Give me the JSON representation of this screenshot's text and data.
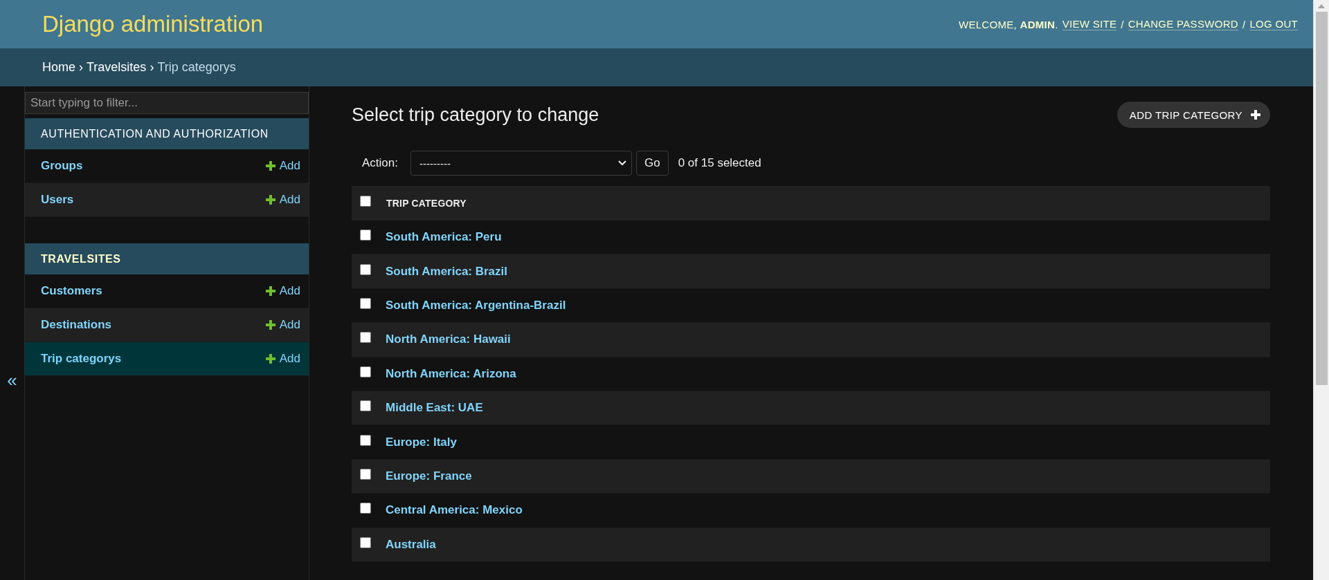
{
  "header": {
    "title": "Django administration",
    "welcome": "WELCOME, **ADMIN**.",
    "links": [
      "VIEW SITE",
      "CHANGE PASSWORD",
      "LOG OUT"
    ],
    "separator": "/"
  },
  "breadcrumbs": {
    "items": [
      "Home",
      "Travelsites",
      "Trip categorys"
    ],
    "separator": "›"
  },
  "sidebar": {
    "filter": {
      "placeholder": "Start typing to filter..."
    },
    "toggle": "«",
    "modules": [
      {
        "title": "AUTHENTICATION AND AUTHORIZATION",
        "current": false,
        "models": [
          {
            "name": "Groups",
            "add": "Add",
            "selected": false
          },
          {
            "name": "Users",
            "add": "Add",
            "selected": false
          }
        ]
      },
      {
        "title": "TRAVELSITES",
        "current": true,
        "models": [
          {
            "name": "Customers",
            "add": "Add",
            "selected": false
          },
          {
            "name": "Destinations",
            "add": "Add",
            "selected": false
          },
          {
            "name": "Trip categorys",
            "add": "Add",
            "selected": true
          }
        ]
      }
    ]
  },
  "content": {
    "title": "Select trip category to change",
    "add_button": "ADD TRIP CATEGORY",
    "actions": {
      "label": "Action:",
      "value": "---------",
      "go": "Go",
      "counter": "0 of 15 selected"
    },
    "table": {
      "columns": [
        "TRIP CATEGORY"
      ],
      "select_all": {
        "checked": false
      },
      "rows": [
        {
          "name": "South America: Peru",
          "checked": false
        },
        {
          "name": "South America: Brazil",
          "checked": false
        },
        {
          "name": "South America: Argentina-Brazil",
          "checked": false
        },
        {
          "name": "North America: Hawaii",
          "checked": false
        },
        {
          "name": "North America: Arizona",
          "checked": false
        },
        {
          "name": "Middle East: UAE",
          "checked": false
        },
        {
          "name": "Europe: Italy",
          "checked": false
        },
        {
          "name": "Europe: France",
          "checked": false
        },
        {
          "name": "Central America: Mexico",
          "checked": false
        },
        {
          "name": "Australia",
          "checked": false
        }
      ]
    }
  }
}
